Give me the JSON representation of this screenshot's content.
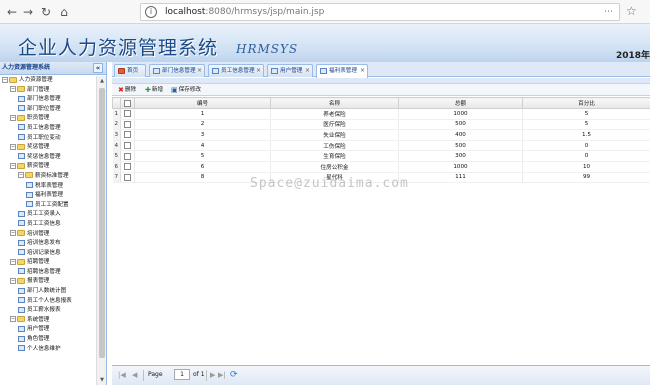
{
  "browser": {
    "url_host": "localhost",
    "url_path": ":8080/hrmsys/jsp/main.jsp",
    "info_icon": "info-icon",
    "ext_icon": "extension-icon",
    "star_icon": "star-icon",
    "info_glyph": "i",
    "ext_glyph": "⋯",
    "back_glyph": "←",
    "forward_glyph": "→",
    "reload_glyph": "↻",
    "home_glyph": "⌂",
    "star_glyph": "☆"
  },
  "header": {
    "title": "企业人力资源管理系统",
    "logo": "HRMSYS",
    "date": "2018年"
  },
  "sidebar": {
    "title": "人力资源管理系统",
    "collapse_glyph": "«",
    "scroll_up": "▲",
    "scroll_down": "▼",
    "items": [
      {
        "label": "人力资源管理",
        "level": 0,
        "type": "folder"
      },
      {
        "label": "部门管理",
        "level": 1,
        "type": "folder"
      },
      {
        "label": "部门信息管理",
        "level": 2,
        "type": "leaf"
      },
      {
        "label": "部门职位管理",
        "level": 2,
        "type": "leaf"
      },
      {
        "label": "职员管理",
        "level": 1,
        "type": "folder"
      },
      {
        "label": "员工信息管理",
        "level": 2,
        "type": "leaf"
      },
      {
        "label": "员工职位变动",
        "level": 2,
        "type": "leaf"
      },
      {
        "label": "奖惩管理",
        "level": 1,
        "type": "folder"
      },
      {
        "label": "奖惩信息管理",
        "level": 2,
        "type": "leaf"
      },
      {
        "label": "薪资管理",
        "level": 1,
        "type": "folder"
      },
      {
        "label": "薪资标准管理",
        "level": 2,
        "type": "folder"
      },
      {
        "label": "税率表管理",
        "level": 3,
        "type": "leaf"
      },
      {
        "label": "福利表管理",
        "level": 3,
        "type": "leaf"
      },
      {
        "label": "员工工资配置",
        "level": 3,
        "type": "leaf"
      },
      {
        "label": "员工工资录入",
        "level": 2,
        "type": "leaf"
      },
      {
        "label": "员工工资信息",
        "level": 2,
        "type": "leaf"
      },
      {
        "label": "培训管理",
        "level": 1,
        "type": "folder"
      },
      {
        "label": "培训信息发布",
        "level": 2,
        "type": "leaf"
      },
      {
        "label": "培训记录信息",
        "level": 2,
        "type": "leaf"
      },
      {
        "label": "招聘管理",
        "level": 1,
        "type": "folder"
      },
      {
        "label": "招聘信息管理",
        "level": 2,
        "type": "leaf"
      },
      {
        "label": "报表管理",
        "level": 1,
        "type": "folder"
      },
      {
        "label": "部门人数统计图",
        "level": 2,
        "type": "leaf"
      },
      {
        "label": "员工个人信息报表",
        "level": 2,
        "type": "leaf"
      },
      {
        "label": "员工薪水报表",
        "level": 2,
        "type": "leaf"
      },
      {
        "label": "系统管理",
        "level": 1,
        "type": "folder"
      },
      {
        "label": "用户管理",
        "level": 2,
        "type": "leaf"
      },
      {
        "label": "角色管理",
        "level": 2,
        "type": "leaf"
      },
      {
        "label": "个人信息维护",
        "level": 2,
        "type": "leaf"
      }
    ]
  },
  "tabs": [
    {
      "label": "首页",
      "icon": "home-icon",
      "closable": false,
      "active": false
    },
    {
      "label": "部门信息管理",
      "icon": "page-icon",
      "closable": true,
      "active": false
    },
    {
      "label": "员工信息管理",
      "icon": "page-icon",
      "closable": true,
      "active": false
    },
    {
      "label": "用户管理",
      "icon": "page-icon",
      "closable": true,
      "active": false
    },
    {
      "label": "福利表管理",
      "icon": "page-icon",
      "closable": true,
      "active": true
    }
  ],
  "tab_close_glyph": "×",
  "toolbar": {
    "delete_label": "删除",
    "add_label": "新增",
    "save_label": "保存修改",
    "delete_glyph": "✖",
    "add_glyph": "✚",
    "save_glyph": "▣"
  },
  "grid": {
    "columns": [
      "",
      "",
      "编号",
      "名称",
      "总额",
      "百分比"
    ],
    "rows": [
      [
        "1",
        "1",
        "养老保险",
        "1000",
        "5"
      ],
      [
        "2",
        "2",
        "医疗保险",
        "500",
        "5"
      ],
      [
        "3",
        "3",
        "失业保险",
        "400",
        "1.5"
      ],
      [
        "4",
        "4",
        "工伤保险",
        "500",
        "0"
      ],
      [
        "5",
        "5",
        "生育保险",
        "300",
        "0"
      ],
      [
        "6",
        "6",
        "住房公积金",
        "1000",
        "10"
      ],
      [
        "7",
        "8",
        "星代科",
        "111",
        "99"
      ]
    ]
  },
  "watermark": "Space@zuidaima.com",
  "pager": {
    "page_label": "Page",
    "current_page": "1",
    "of_label": "of 1",
    "first_glyph": "|◀",
    "prev_glyph": "◀",
    "next_glyph": "▶",
    "last_glyph": "▶|",
    "refresh_glyph": "⟳"
  }
}
